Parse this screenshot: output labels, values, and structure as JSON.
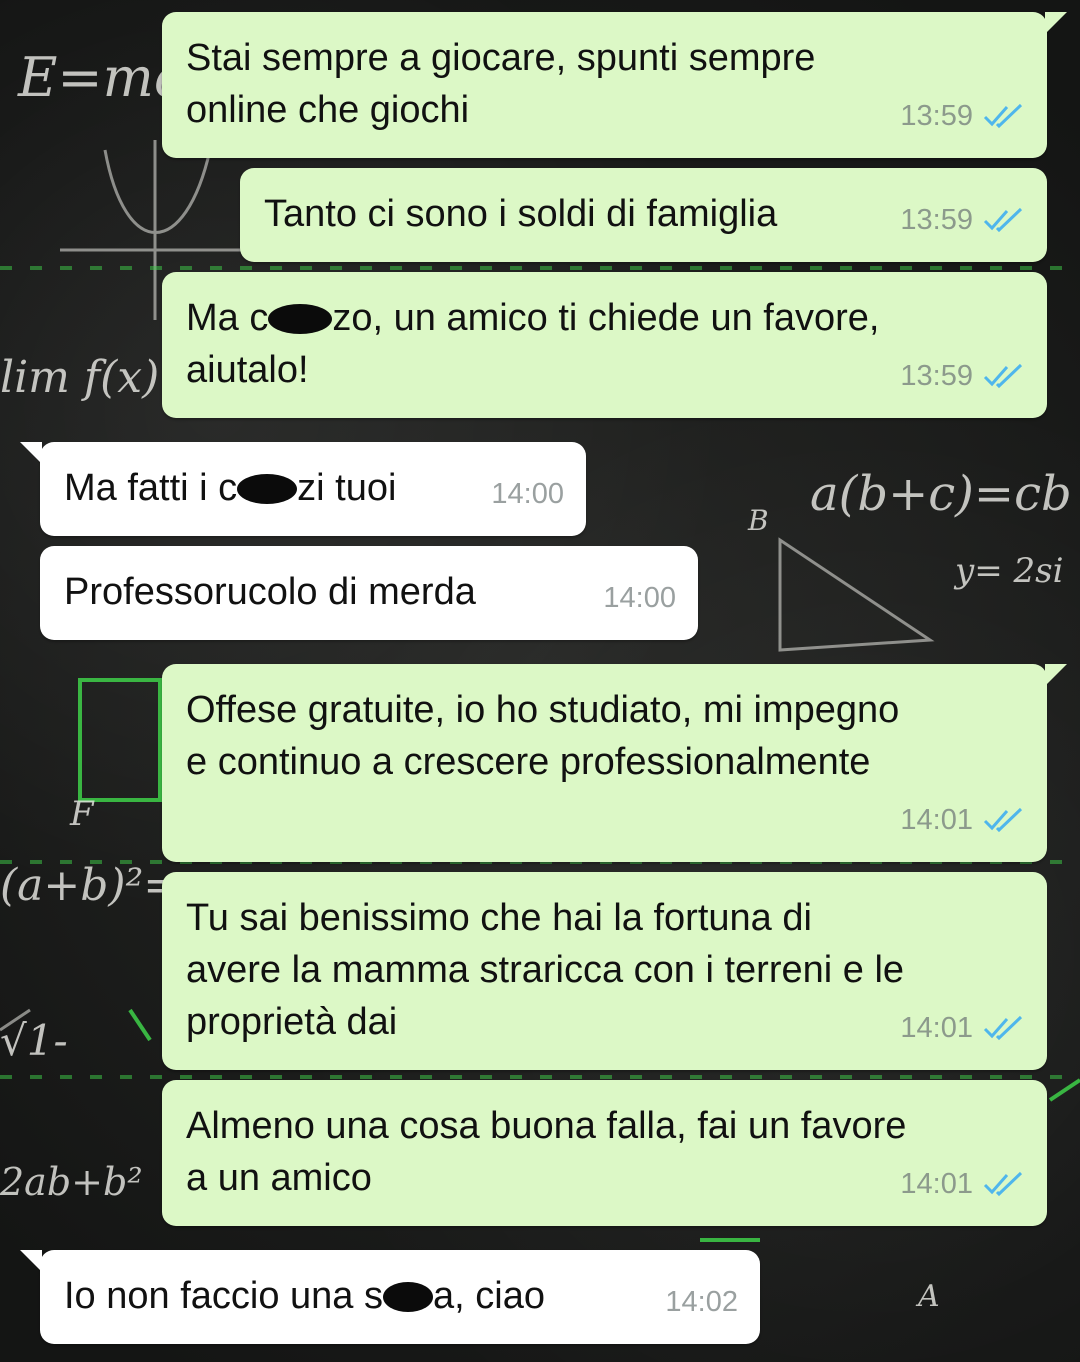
{
  "messages": [
    {
      "direction": "out",
      "lines": [
        "Stai sempre a giocare, spunti sempre",
        "online che giochi"
      ],
      "time": "13:59",
      "status": "read-double-tick"
    },
    {
      "direction": "out",
      "lines": [
        "Tanto ci sono i soldi di famiglia"
      ],
      "time": "13:59",
      "status": "read-double-tick"
    },
    {
      "direction": "out",
      "lines_parts": [
        [
          "Ma c",
          "zo, un amico ti chiede un favore,"
        ],
        [
          "aiutalo!"
        ]
      ],
      "time": "13:59",
      "status": "read-double-tick"
    },
    {
      "direction": "in",
      "parts": [
        "Ma fatti i c",
        "zi tuoi"
      ],
      "time": "14:00"
    },
    {
      "direction": "in",
      "lines": [
        "Professorucolo di merda"
      ],
      "time": "14:00"
    },
    {
      "direction": "out",
      "lines": [
        "Offese gratuite, io ho studiato, mi impegno",
        "e continuo a crescere professionalmente"
      ],
      "time": "14:01",
      "status": "read-double-tick"
    },
    {
      "direction": "out",
      "lines": [
        "Tu sai benissimo che hai la fortuna di",
        "avere la mamma straricca con i terreni e le",
        "proprietà dai"
      ],
      "time": "14:01",
      "status": "read-double-tick"
    },
    {
      "direction": "out",
      "lines": [
        "Almeno una cosa buona falla, fai un favore",
        "a un amico"
      ],
      "time": "14:01",
      "status": "read-double-tick"
    },
    {
      "direction": "in",
      "parts": [
        "Io non faccio una s",
        "a, ciao"
      ],
      "time": "14:02"
    }
  ],
  "colors": {
    "outgoing_bubble": "#dcf8c6",
    "incoming_bubble": "#ffffff",
    "read_tick": "#4fb6ec",
    "chalk_green": "#3fd14a"
  },
  "icons": {
    "read_status": "double-check-icon"
  }
}
